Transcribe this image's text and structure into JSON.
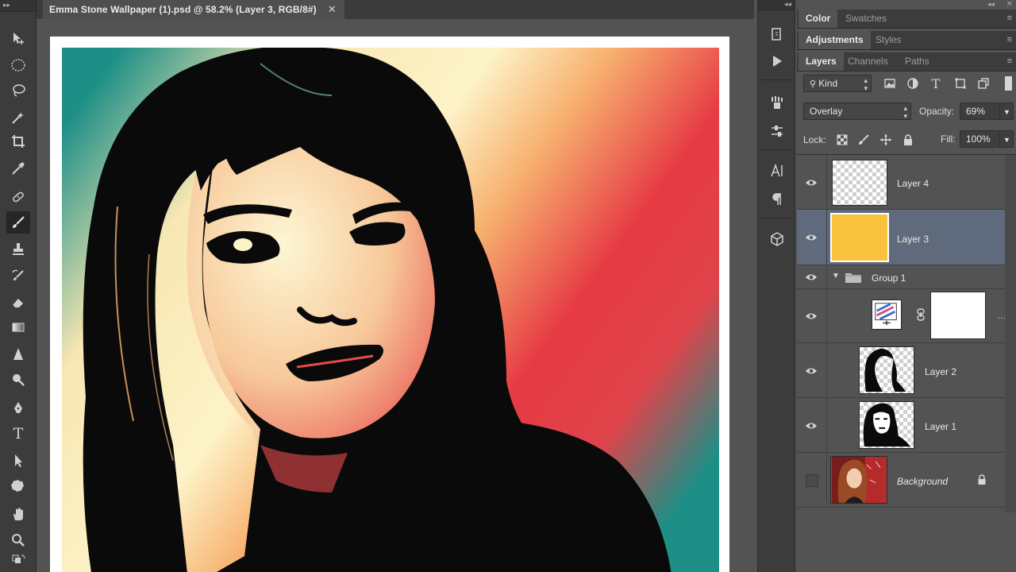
{
  "document": {
    "tab_title": "Emma Stone Wallpaper (1).psd @ 58.2% (Layer 3, RGB/8#)",
    "close_glyph": "✕"
  },
  "toolbar": {
    "active_tool": "brush-tool",
    "tools": [
      "move",
      "elliptical-marquee",
      "lasso",
      "magic-wand",
      "crop",
      "eyedropper",
      "healing-brush",
      "brush",
      "clone-stamp",
      "history-brush",
      "eraser",
      "gradient",
      "blur",
      "dodge",
      "pen",
      "type",
      "path-selection",
      "custom-shape",
      "hand",
      "zoom"
    ]
  },
  "panels": {
    "top_tabs": [
      "Color",
      "Swatches"
    ],
    "adjust_tabs": [
      "Adjustments",
      "Styles"
    ],
    "layer_tabs": [
      "Layers",
      "Channels",
      "Paths"
    ],
    "menu_glyph": "≡"
  },
  "layers_panel": {
    "kind_label": "Kind",
    "blend_mode": "Overlay",
    "opacity_label": "Opacity:",
    "opacity_value": "69%",
    "lock_label": "Lock:",
    "fill_label": "Fill:",
    "fill_value": "100%",
    "layers": [
      {
        "name": "Layer 4",
        "visible": true,
        "selected": false,
        "thumb": "transparent"
      },
      {
        "name": "Layer 3",
        "visible": true,
        "selected": true,
        "thumb": "#f9c23c"
      },
      {
        "name": "Group 1",
        "visible": true,
        "selected": false,
        "thumb": "folder"
      },
      {
        "name": "",
        "visible": true,
        "selected": false,
        "thumb": "gradient-map-adjustment"
      },
      {
        "name": "Layer 2",
        "visible": true,
        "selected": false,
        "thumb": "hair-silhouette"
      },
      {
        "name": "Layer 1",
        "visible": true,
        "selected": false,
        "thumb": "face-silhouette"
      },
      {
        "name": "Background",
        "visible": false,
        "selected": false,
        "thumb": "photo",
        "locked": true
      }
    ]
  },
  "colors": {
    "selected_layer_bg": "#5f6b7c",
    "layer3_fill": "#f9c23c",
    "art_teal": "#1e8f86",
    "art_cream": "#fdf3c8",
    "art_red": "#e63a44"
  }
}
